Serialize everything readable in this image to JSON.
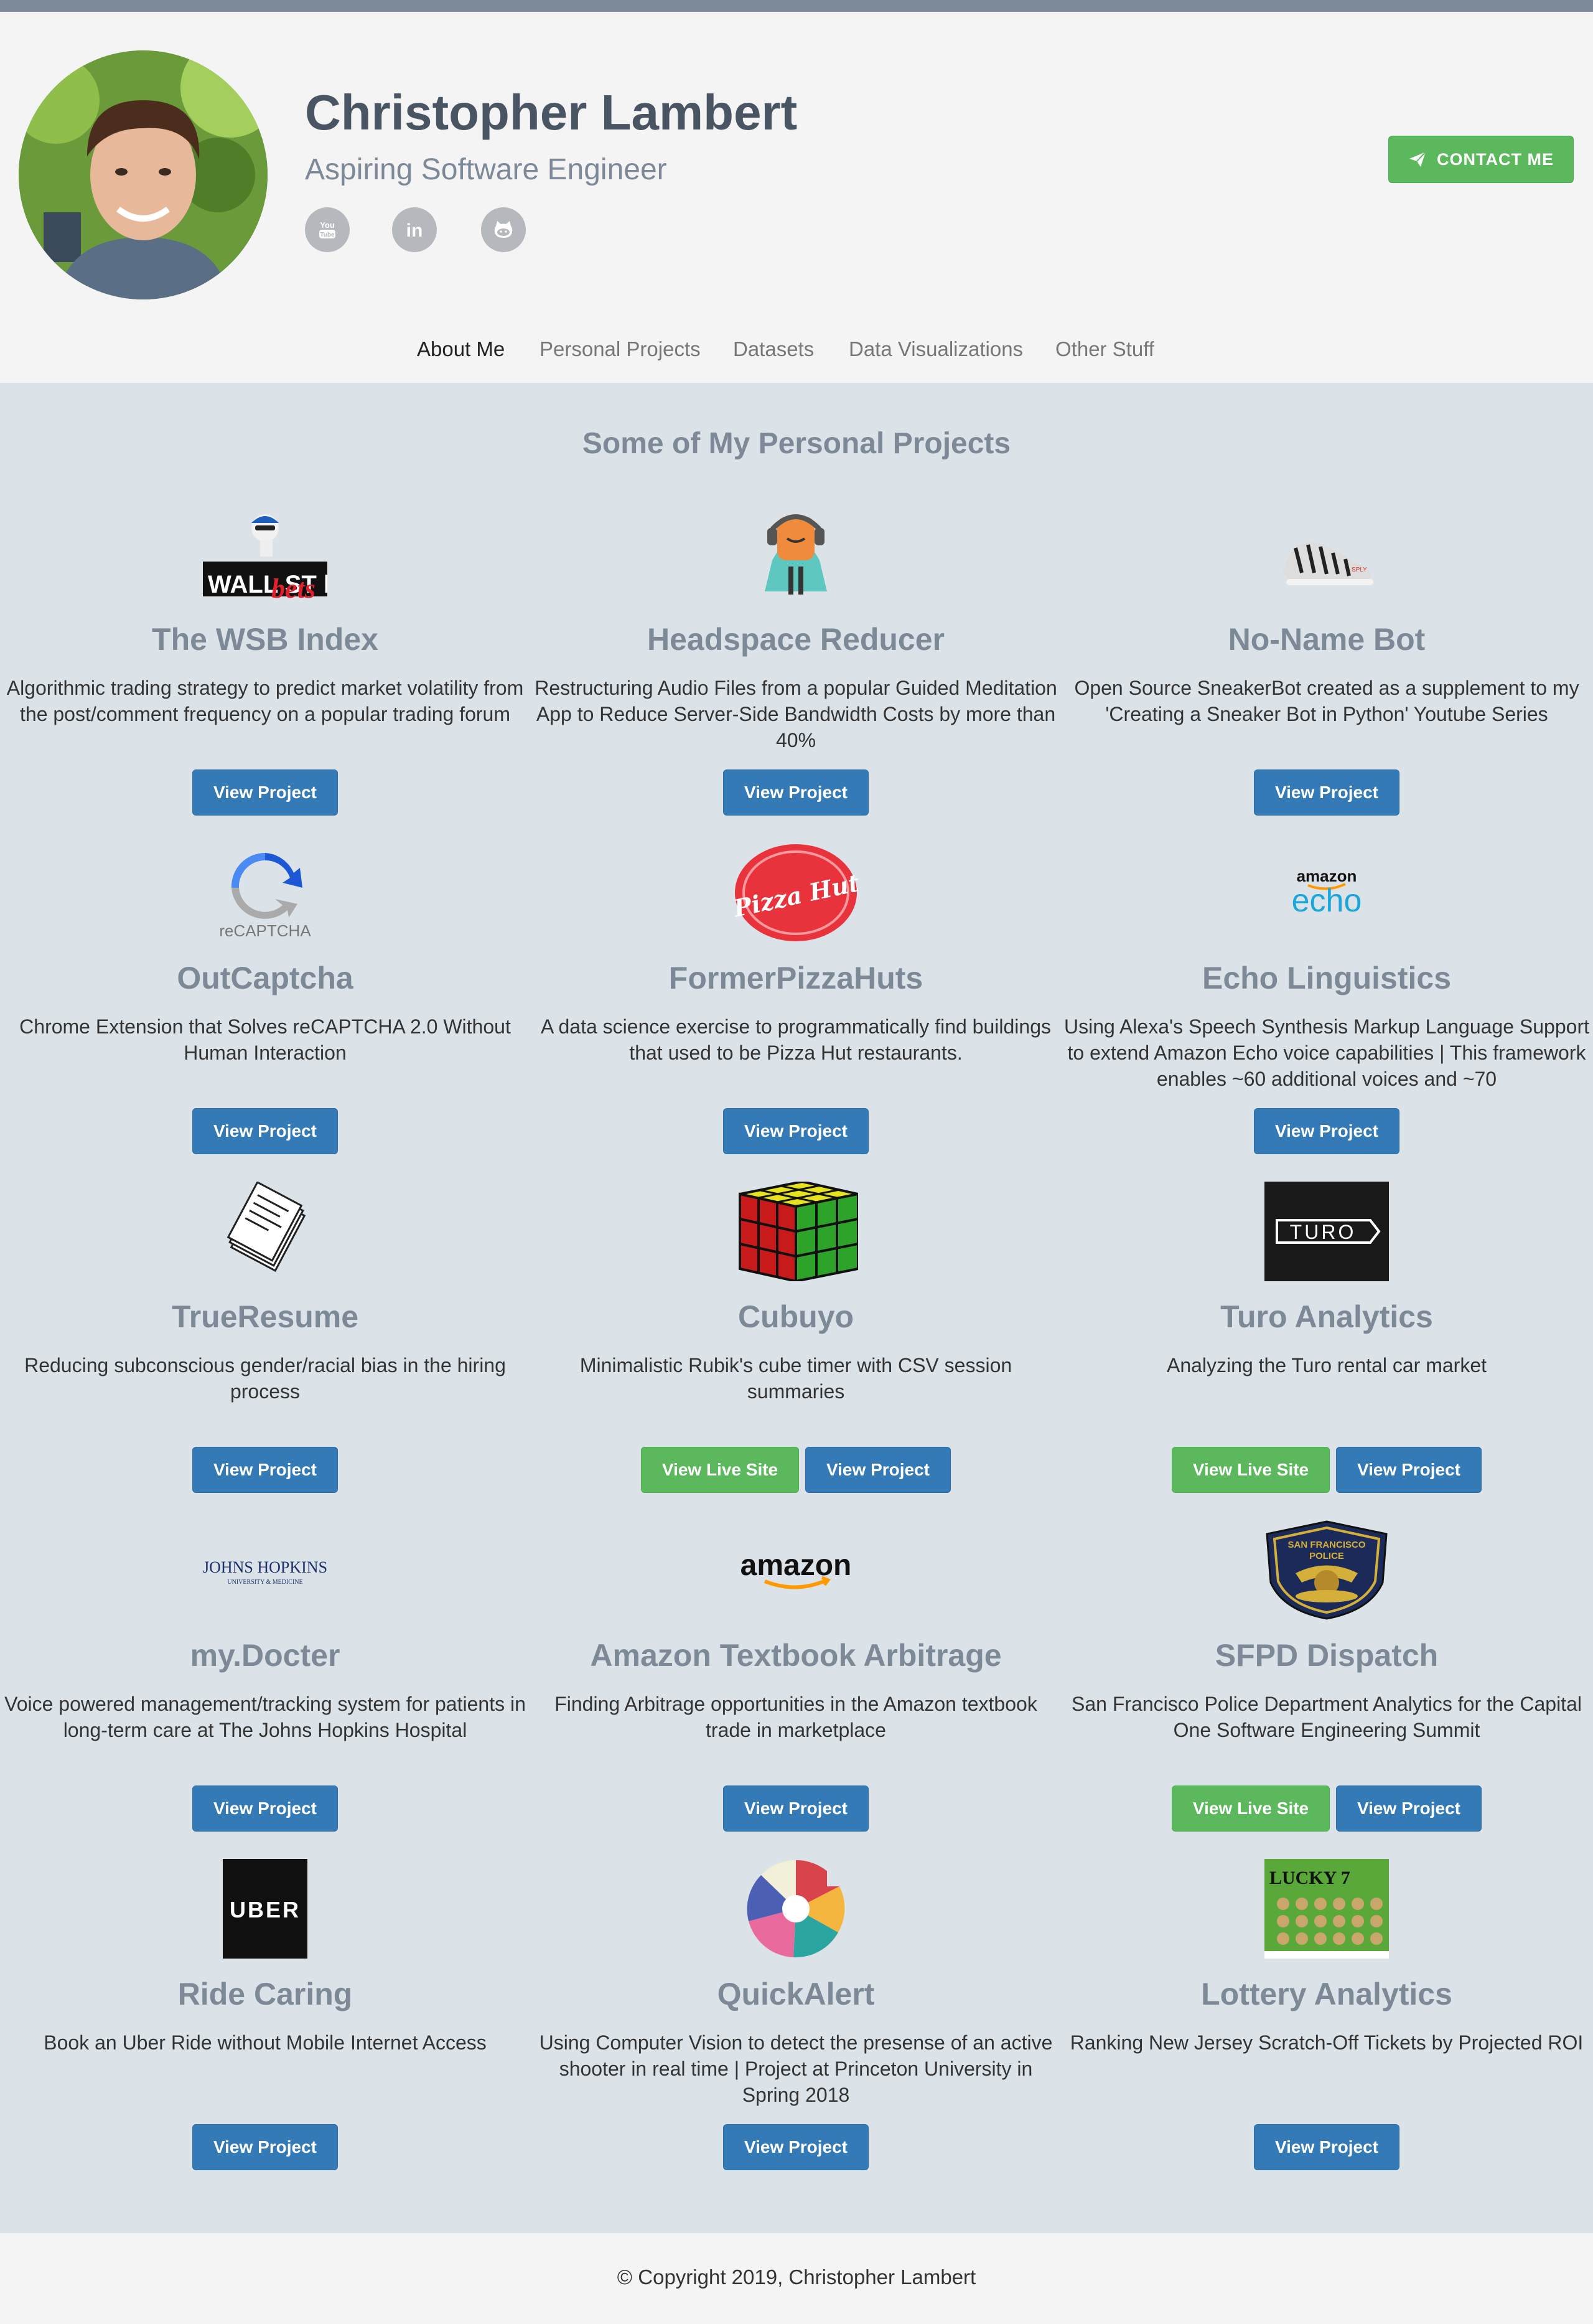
{
  "profile": {
    "name": "Christopher Lambert",
    "subtitle": "Aspiring Software Engineer",
    "contact_label": "CONTACT ME",
    "social_icons": [
      "youtube-icon",
      "linkedin-icon",
      "github-icon"
    ]
  },
  "nav": {
    "items": [
      "About Me",
      "Personal Projects",
      "Datasets",
      "Data Visualizations",
      "Other Stuff"
    ],
    "active": "About Me"
  },
  "main": {
    "section_title": "Some of My Personal Projects",
    "projects": [
      {
        "title": "The WSB Index",
        "description": "Algorithmic trading strategy to predict market volatility from the post/comment frequency on a popular trading forum",
        "buttons": [
          "View Project"
        ],
        "logo": "wallstreetbets-logo",
        "logo_text": "WALL ST bets"
      },
      {
        "title": "Headspace Reducer",
        "description": "Restructuring Audio Files from a popular Guided Meditation App to Reduce Server-Side Bandwidth Costs by more than 40%",
        "buttons": [
          "View Project"
        ],
        "logo": "headspace-logo"
      },
      {
        "title": "No-Name Bot",
        "description": "Open Source SneakerBot created as a supplement to my 'Creating a Sneaker Bot in Python' Youtube Series",
        "buttons": [
          "View Project"
        ],
        "logo": "sneaker-image"
      },
      {
        "title": "OutCaptcha",
        "description": "Chrome Extension that Solves reCAPTCHA 2.0 Without Human Interaction",
        "buttons": [
          "View Project"
        ],
        "logo": "recaptcha-logo",
        "logo_text": "reCAPTCHA"
      },
      {
        "title": "FormerPizzaHuts",
        "description": "A data science exercise to programmatically find buildings that used to be Pizza Hut restaurants.",
        "buttons": [
          "View Project"
        ],
        "logo": "pizza-hut-logo",
        "logo_text": "Pizza Hut"
      },
      {
        "title": "Echo Linguistics",
        "description": "Using Alexa's Speech Synthesis Markup Language Support to extend Amazon Echo voice capabilities | This framework enables ~60 additional voices and ~70",
        "buttons": [
          "View Project"
        ],
        "logo": "amazon-echo-logo",
        "logo_text": [
          "amazon",
          "echo"
        ]
      },
      {
        "title": "TrueResume",
        "description": "Reducing subconscious gender/racial bias in the hiring process",
        "buttons": [
          "View Project"
        ],
        "logo": "resume-papers-image"
      },
      {
        "title": "Cubuyo",
        "description": "Minimalistic Rubik's cube timer with CSV session summaries",
        "buttons": [
          "View Live Site",
          "View Project"
        ],
        "logo": "rubiks-cube-image"
      },
      {
        "title": "Turo Analytics",
        "description": "Analyzing the Turo rental car market",
        "buttons": [
          "View Live Site",
          "View Project"
        ],
        "logo": "turo-logo",
        "logo_text": "TURO"
      },
      {
        "title": "my.Docter",
        "description": "Voice powered management/tracking system for patients in long-term care at The Johns Hopkins Hospital",
        "buttons": [
          "View Project"
        ],
        "logo": "johns-hopkins-logo",
        "logo_text": [
          "JOHNS HOPKINS",
          "UNIVERSITY & MEDICINE"
        ]
      },
      {
        "title": "Amazon Textbook Arbitrage",
        "description": "Finding Arbitrage opportunities in the Amazon textbook trade in marketplace",
        "buttons": [
          "View Project"
        ],
        "logo": "amazon-logo",
        "logo_text": "amazon"
      },
      {
        "title": "SFPD Dispatch",
        "description": "San Francisco Police Department Analytics for the Capital One Software Engineering Summit",
        "buttons": [
          "View Live Site",
          "View Project"
        ],
        "logo": "sfpd-badge",
        "logo_text": [
          "SAN FRANCISCO",
          "POLICE"
        ]
      },
      {
        "title": "Ride Caring",
        "description": "Book an Uber Ride without Mobile Internet Access",
        "buttons": [
          "View Project"
        ],
        "logo": "uber-logo",
        "logo_text": "UBER"
      },
      {
        "title": "QuickAlert",
        "description": "Using Computer Vision to detect the presense of an active shooter in real time | Project at Princeton University in Spring 2018",
        "buttons": [
          "View Project"
        ],
        "logo": "quickalert-logo"
      },
      {
        "title": "Lottery Analytics",
        "description": "Ranking New Jersey Scratch-Off Tickets by Projected ROI",
        "buttons": [
          "View Project"
        ],
        "logo": "lottery-ticket-image",
        "logo_text": "LUCKY 7"
      }
    ]
  },
  "footer": {
    "copyright": "© Copyright 2019, Christopher Lambert"
  },
  "colors": {
    "header_bg": "#f4f4f4",
    "content_bg": "#dce3e8",
    "primary_button": "#337ab7",
    "success_button": "#5cb85c",
    "heading_gray": "#7d8997",
    "name_color": "#4a5564"
  }
}
